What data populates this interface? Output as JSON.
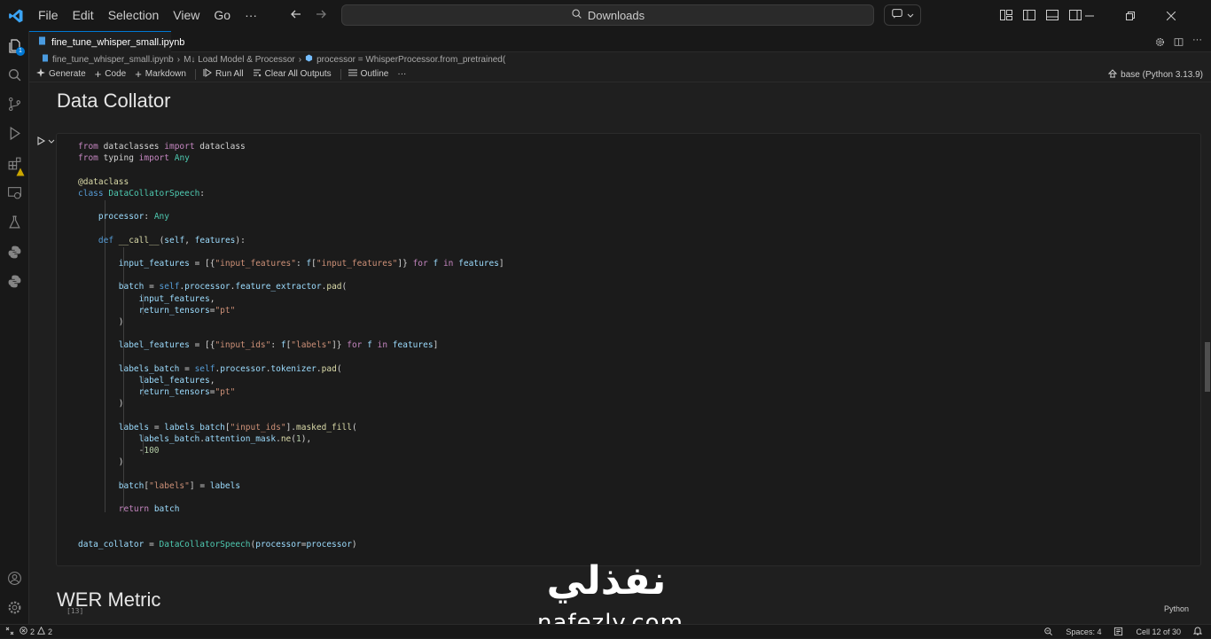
{
  "menu": [
    "File",
    "Edit",
    "Selection",
    "View",
    "Go"
  ],
  "menu_more": "···",
  "search": {
    "text": "Downloads"
  },
  "tab": {
    "title": "fine_tune_whisper_small.ipynb"
  },
  "breadcrumb": {
    "file": "fine_tune_whisper_small.ipynb",
    "section": "M↓ Load Model & Processor",
    "symbol": "processor = WhisperProcessor.from_pretrained("
  },
  "toolbar": {
    "generate": "Generate",
    "code": "Code",
    "markdown": "Markdown",
    "run_all": "Run All",
    "clear_all_outputs": "Clear All Outputs",
    "outline": "Outline",
    "more": "···",
    "kernel": "base (Python 3.13.9)"
  },
  "notebook": {
    "heading_1": "Data Collator",
    "heading_2": "WER Metric",
    "cell": {
      "exec_count": "[13]",
      "language": "Python"
    }
  },
  "activity": {
    "explorer_badge": "1"
  },
  "status": {
    "errors": "2",
    "warnings": "2",
    "spaces": "Spaces: 4",
    "cell_pos": "Cell 12 of 30"
  },
  "watermark": {
    "arabic": "نفذلي",
    "latin": "nafezly.com"
  },
  "colors": {
    "accent": "#0078d4",
    "background": "#1f1f1f"
  }
}
